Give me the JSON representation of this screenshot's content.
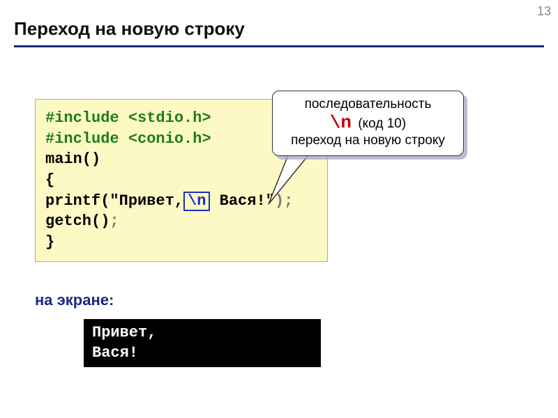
{
  "page_number": "13",
  "title": "Переход на новую строку",
  "code": {
    "inc1_a": "#include ",
    "inc1_b": "<stdio.h>",
    "inc2_a": "#include ",
    "inc2_b": "<conio.h>",
    "main": "main()",
    "brace_open": "{",
    "printf_a": "printf(",
    "printf_b": "\"Привет,",
    "escape": "\\n",
    "printf_c": " Вася!\"",
    "printf_d": ");",
    "getch_a": "getch()",
    "getch_b": ";",
    "brace_close": "}"
  },
  "callout": {
    "line1": "последовательность",
    "esc": "\\n",
    "code_note": "(код 10)",
    "line2": "переход на новую строку"
  },
  "screen_label": "на экране:",
  "console_output": "Привет,\nВася!"
}
